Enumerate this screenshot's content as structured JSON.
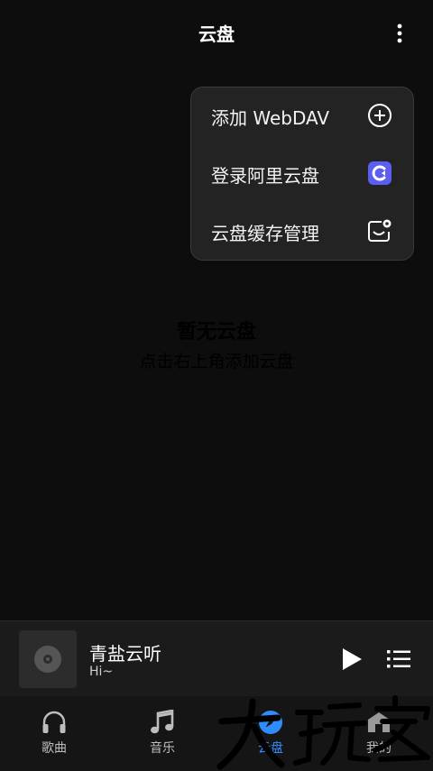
{
  "header": {
    "title": "云盘",
    "more_icon": "more-vertical-icon"
  },
  "menu": {
    "items": [
      {
        "label": "添加 WebDAV",
        "icon": "add-circle-icon"
      },
      {
        "label": "登录阿里云盘",
        "icon": "aliyun-drive-icon"
      },
      {
        "label": "云盘缓存管理",
        "icon": "cache-settings-icon"
      }
    ]
  },
  "empty_state": {
    "title": "暂无云盘",
    "hint": "点击右上角添加云盘"
  },
  "player": {
    "song": "青盐云听",
    "artist": "Hi~",
    "play_icon": "play-icon",
    "playlist_icon": "playlist-icon"
  },
  "tabs": [
    {
      "label": "歌曲",
      "icon": "headphones-icon",
      "active": false
    },
    {
      "label": "音乐",
      "icon": "music-note-icon",
      "active": false
    },
    {
      "label": "云盘",
      "icon": "compass-icon",
      "active": true
    },
    {
      "label": "我的",
      "icon": "profile-icon",
      "active": false
    }
  ],
  "watermark": {
    "logo": "site-watermark-logo"
  },
  "colors": {
    "background": "#0d0d0d",
    "menu": "#232323",
    "accent": "#2f8cff",
    "aliyun_icon": "#5b5ef0"
  }
}
